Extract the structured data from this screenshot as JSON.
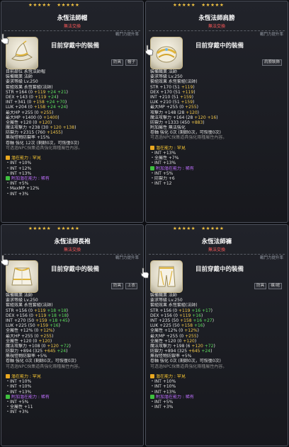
{
  "colors": {
    "star": "#f5c542",
    "potential": "#5ee05e",
    "bonus": "#f3c84a",
    "rare_purple": "#c070ff",
    "subtitle_red": "#ff5a5a"
  },
  "tooltips": [
    {
      "title": "永恆法師帽",
      "subtitle": "無法交換",
      "deco": "戰鬥力提升率",
      "equipped": "目前穿戴中的裝備",
      "tags": [
        "防具",
        "帽子"
      ],
      "stars_filled": 5,
      "stars_empty": 0,
      "icon": "mage-hat-icon",
      "lines": [
        [
          [
            "w",
            "目前部位"
          ],
          [
            "w",
            "  永恆法師帽"
          ]
        ],
        [
          [
            "w",
            "裝備職業"
          ],
          [
            "w",
            "  法師"
          ]
        ],
        [
          [
            "w",
            "要求等級"
          ],
          [
            "w",
            "  Lv.250"
          ]
        ],
        [
          [
            "w",
            "套組效果"
          ],
          [
            "w",
            "  永恆套組(法師)"
          ]
        ],
        [
          [
            "w",
            "STR  +164  (0 "
          ],
          [
            "y",
            "+119 "
          ],
          [
            "g",
            "+24 +21"
          ],
          [
            "w",
            ")"
          ]
        ],
        [
          [
            "w",
            "DEX  +143  (0 "
          ],
          [
            "y",
            "+119 "
          ],
          [
            "g",
            "+24"
          ],
          [
            "w",
            ")"
          ]
        ],
        [
          [
            "w",
            "INT  +341  (0 "
          ],
          [
            "y",
            "+158 "
          ],
          [
            "g",
            "+24 +70"
          ],
          [
            "w",
            ")"
          ]
        ],
        [
          [
            "w",
            "LUK  +204  (0 "
          ],
          [
            "y",
            "+158 "
          ],
          [
            "g",
            "+24 +24"
          ],
          [
            "w",
            ")"
          ]
        ],
        [
          [
            "w",
            "最大HP  +255  (0 "
          ],
          [
            "y",
            "+255"
          ],
          [
            "w",
            ")"
          ]
        ],
        [
          [
            "w",
            "最大MP  +1400  (0 "
          ],
          [
            "y",
            "+1400"
          ],
          [
            "w",
            ")"
          ]
        ],
        [
          [
            "w",
            "全屬性  +120  (0 "
          ],
          [
            "y",
            "+120"
          ],
          [
            "w",
            ")"
          ]
        ],
        [
          [
            "w",
            "魔法攻擊力  +238  (30 "
          ],
          [
            "y",
            "+120 +138"
          ],
          [
            "w",
            ")"
          ]
        ],
        [
          [
            "w",
            "防禦力  +2315  (760 "
          ],
          [
            "y",
            "+1455"
          ],
          [
            "w",
            ")"
          ]
        ],
        [
          [
            "w",
            "無視怪物防禦率  +15%"
          ]
        ],
        [
          [
            "w",
            "卷軸 強化 12次  (剩餘0次，可恢復0次)"
          ]
        ],
        [
          [
            "gr",
            "可透過NPC採集道具強化兩種屬性內容。"
          ]
        ],
        [
          [
            "gr",
            " "
          ]
        ],
        [
          [
            "gold",
            "潛在能力 : 罕見"
          ]
        ],
        [
          [
            "w",
            "・INT  +10%"
          ]
        ],
        [
          [
            "w",
            "・INT  +12%"
          ]
        ],
        [
          [
            "w",
            "・INT  +13%"
          ]
        ],
        [
          [
            "p",
            "附加潛在能力 : 稀有"
          ]
        ],
        [
          [
            "w",
            "・INT  +5%"
          ]
        ],
        [
          [
            "w",
            "・MaxMP  +12%"
          ]
        ],
        [
          [
            "w",
            "・INT  +3%"
          ]
        ]
      ]
    },
    {
      "title": "永恆法師肩膀",
      "subtitle": "無法交換",
      "deco": "戰鬥力提升率",
      "equipped": "目前穿戴中的裝備",
      "tags": [
        "肩膀裝飾"
      ],
      "stars_filled": 5,
      "stars_empty": 0,
      "icon": "shoulder-icon",
      "lines": [
        [
          [
            "w",
            "裝備職業"
          ],
          [
            "w",
            "  法師"
          ]
        ],
        [
          [
            "w",
            "要求等級"
          ],
          [
            "w",
            "  Lv.250"
          ]
        ],
        [
          [
            "w",
            "套組效果"
          ],
          [
            "w",
            "  永恆套組(法師)"
          ]
        ],
        [
          [
            "w",
            "STR  +170  (51 "
          ],
          [
            "y",
            "+119"
          ],
          [
            "w",
            ")"
          ]
        ],
        [
          [
            "w",
            "DEX  +170  (51 "
          ],
          [
            "y",
            "+119"
          ],
          [
            "w",
            ")"
          ]
        ],
        [
          [
            "w",
            "INT  +210  (51 "
          ],
          [
            "y",
            "+159"
          ],
          [
            "w",
            ")"
          ]
        ],
        [
          [
            "w",
            "LUK  +210  (51 "
          ],
          [
            "y",
            "+159"
          ],
          [
            "w",
            ")"
          ]
        ],
        [
          [
            "w",
            "最大MP  +255  (0 "
          ],
          [
            "y",
            "+255"
          ],
          [
            "w",
            ")"
          ]
        ],
        [
          [
            "w",
            "攻擊力  +148  (28 "
          ],
          [
            "y",
            "+120"
          ],
          [
            "w",
            ")"
          ]
        ],
        [
          [
            "w",
            "魔法攻擊力  +164  (28 "
          ],
          [
            "y",
            "+120 +16"
          ],
          [
            "w",
            ")"
          ]
        ],
        [
          [
            "w",
            "防禦力  +1333  (450 "
          ],
          [
            "y",
            "+883"
          ],
          [
            "w",
            ")"
          ]
        ],
        [
          [
            "w",
            "附加屬性 無法強化"
          ]
        ],
        [
          [
            "w",
            "卷軸 強化 0次  (剩餘0次，可恢復0次)"
          ]
        ],
        [
          [
            "gr",
            "可透過NPC採集道具強化兩種屬性內容。"
          ]
        ],
        [
          [
            "gr",
            " "
          ]
        ],
        [
          [
            "gold",
            "潛在能力 : 罕見"
          ]
        ],
        [
          [
            "w",
            "・INT  +13%"
          ]
        ],
        [
          [
            "w",
            "・全屬性  +7%"
          ]
        ],
        [
          [
            "w",
            "・INT  +13%"
          ]
        ],
        [
          [
            "p",
            "附加潛在能力 : 稀有"
          ]
        ],
        [
          [
            "w",
            "・INT  +5%"
          ]
        ],
        [
          [
            "w",
            "・防禦力  +6"
          ]
        ],
        [
          [
            "w",
            "・INT  +12"
          ]
        ]
      ]
    },
    {
      "title": "永恆法師長袍",
      "subtitle": "無法交換",
      "deco": "戰鬥力提升率",
      "equipped": "目前穿戴中的裝備",
      "tags": [
        "防具",
        "上衣"
      ],
      "stars_filled": 5,
      "stars_empty": 0,
      "icon": "robe-icon",
      "lines": [
        [
          [
            "w",
            "裝備職業"
          ],
          [
            "w",
            "  法師"
          ]
        ],
        [
          [
            "w",
            "要求等級"
          ],
          [
            "w",
            "  Lv.250"
          ]
        ],
        [
          [
            "w",
            "套組效果"
          ],
          [
            "w",
            "  永恆套組(法師)"
          ]
        ],
        [
          [
            "w",
            "STR  +156  (0 "
          ],
          [
            "y",
            "+119 "
          ],
          [
            "g",
            "+18 +18"
          ],
          [
            "w",
            ")"
          ]
        ],
        [
          [
            "w",
            "DEX  +156  (0 "
          ],
          [
            "y",
            "+119 "
          ],
          [
            "g",
            "+18 +18"
          ],
          [
            "w",
            ")"
          ]
        ],
        [
          [
            "w",
            "INT  +270  (50 "
          ],
          [
            "y",
            "+159 "
          ],
          [
            "g",
            "+18 +45"
          ],
          [
            "w",
            ")"
          ]
        ],
        [
          [
            "w",
            "LUK  +225  (50 "
          ],
          [
            "y",
            "+159 "
          ],
          [
            "g",
            "+16"
          ],
          [
            "w",
            ")"
          ]
        ],
        [
          [
            "w",
            "全屬性  +12%  (0 "
          ],
          [
            "y",
            "+12%"
          ],
          [
            "w",
            ")"
          ]
        ],
        [
          [
            "w",
            "最大HP  +255  (0 "
          ],
          [
            "y",
            "+255"
          ],
          [
            "w",
            ")"
          ]
        ],
        [
          [
            "w",
            "全屬性  +120  (0 "
          ],
          [
            "y",
            "+120"
          ],
          [
            "w",
            ")"
          ]
        ],
        [
          [
            "w",
            "魔法攻擊力  +108  (0 "
          ],
          [
            "y",
            "+120 "
          ],
          [
            "g",
            "+72"
          ],
          [
            "w",
            ")"
          ]
        ],
        [
          [
            "w",
            "防禦力  +894  (325 "
          ],
          [
            "y",
            "+645 "
          ],
          [
            "g",
            "+24"
          ],
          [
            "w",
            ")"
          ]
        ],
        [
          [
            "w",
            "無視怪物防禦率  +5%"
          ]
        ],
        [
          [
            "w",
            "卷軸 強化 0次  (剩餘0次，可恢復0次)"
          ]
        ],
        [
          [
            "gr",
            "可透過NPC採集道具強化兩種屬性內容。"
          ]
        ],
        [
          [
            "gr",
            " "
          ]
        ],
        [
          [
            "gold",
            "潛在能力 : 罕見"
          ]
        ],
        [
          [
            "w",
            "・INT  +10%"
          ]
        ],
        [
          [
            "w",
            "・INT  +10%"
          ]
        ],
        [
          [
            "w",
            "・INT  +13%"
          ]
        ],
        [
          [
            "p",
            "附加潛在能力 : 稀有"
          ]
        ],
        [
          [
            "w",
            "・INT  +5%"
          ]
        ],
        [
          [
            "w",
            "・全屬性  +11"
          ]
        ],
        [
          [
            "w",
            "・INT  +3%"
          ]
        ]
      ]
    },
    {
      "title": "永恆法師褲",
      "subtitle": "無法交換",
      "deco": "戰鬥力提升率",
      "equipped": "目前穿戴中的裝備",
      "tags": [
        "防具",
        "褲/裙"
      ],
      "stars_filled": 5,
      "stars_empty": 0,
      "icon": "pants-icon",
      "lines": [
        [
          [
            "w",
            "裝備職業"
          ],
          [
            "w",
            "  法師"
          ]
        ],
        [
          [
            "w",
            "要求等級"
          ],
          [
            "w",
            "  Lv.250"
          ]
        ],
        [
          [
            "w",
            "套組效果"
          ],
          [
            "w",
            "  永恆套組(法師)"
          ]
        ],
        [
          [
            "w",
            "STR  +156  (0 "
          ],
          [
            "y",
            "+119 "
          ],
          [
            "g",
            "+16 +17"
          ],
          [
            "w",
            ")"
          ]
        ],
        [
          [
            "w",
            "DEX  +156  (0 "
          ],
          [
            "y",
            "+119 "
          ],
          [
            "g",
            "+16"
          ],
          [
            "w",
            ")"
          ]
        ],
        [
          [
            "w",
            "INT  +235  (50 "
          ],
          [
            "y",
            "+158 "
          ],
          [
            "g",
            "+16 +27"
          ],
          [
            "w",
            ")"
          ]
        ],
        [
          [
            "w",
            "LUK  +225  (50 "
          ],
          [
            "y",
            "+158 "
          ],
          [
            "g",
            "+16"
          ],
          [
            "w",
            ")"
          ]
        ],
        [
          [
            "w",
            "全屬性  +12%  (0 "
          ],
          [
            "y",
            "+12%"
          ],
          [
            "w",
            ")"
          ]
        ],
        [
          [
            "w",
            "最大MP  +255  (0 "
          ],
          [
            "y",
            "+255"
          ],
          [
            "w",
            ")"
          ]
        ],
        [
          [
            "w",
            "全屬性  +120  (0 "
          ],
          [
            "y",
            "+120"
          ],
          [
            "w",
            ")"
          ]
        ],
        [
          [
            "w",
            "魔法攻擊力  +198  (6 "
          ],
          [
            "y",
            "+120 "
          ],
          [
            "g",
            "+72"
          ],
          [
            "w",
            ")"
          ]
        ],
        [
          [
            "w",
            "防禦力  +894  (325 "
          ],
          [
            "y",
            "+645 "
          ],
          [
            "g",
            "+24"
          ],
          [
            "w",
            ")"
          ]
        ],
        [
          [
            "w",
            "無視怪物防禦率  +5%"
          ]
        ],
        [
          [
            "w",
            "卷軸 強化 0次  (剩餘0次，可恢復0次)"
          ]
        ],
        [
          [
            "gr",
            "可透過NPC採集道具強化兩種屬性內容。"
          ]
        ],
        [
          [
            "gr",
            " "
          ]
        ],
        [
          [
            "gold",
            "潛在能力 : 罕見"
          ]
        ],
        [
          [
            "w",
            "・INT  +10%"
          ]
        ],
        [
          [
            "w",
            "・INT  +10%"
          ]
        ],
        [
          [
            "w",
            "・INT  +13%"
          ]
        ],
        [
          [
            "p",
            "附加潛在能力 : 稀有"
          ]
        ],
        [
          [
            "w",
            "・INT  +5%"
          ]
        ],
        [
          [
            "w",
            "・INT  +3%"
          ]
        ]
      ]
    }
  ]
}
